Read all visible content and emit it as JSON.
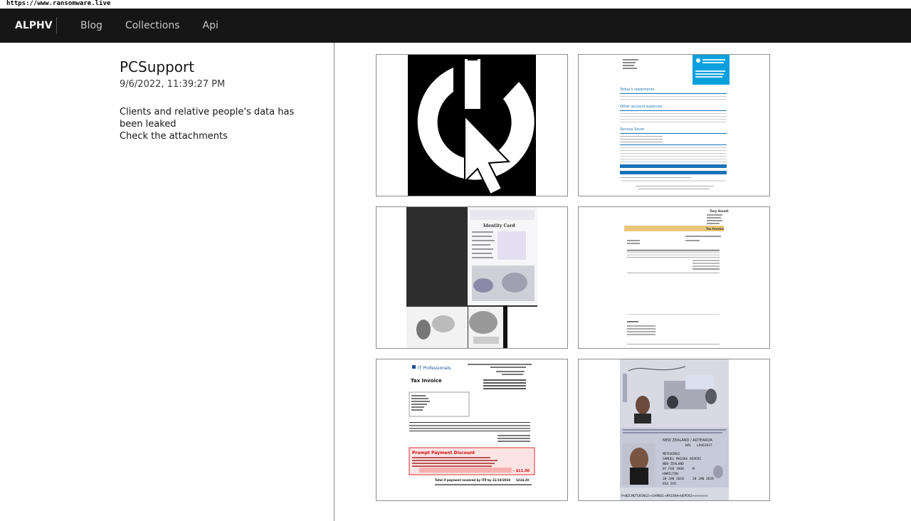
{
  "browser": {
    "url": "https://www.ransomware.live"
  },
  "navbar": {
    "brand": "ALPHV",
    "links": [
      {
        "label": "Blog"
      },
      {
        "label": "Collections"
      },
      {
        "label": "Api"
      }
    ]
  },
  "post": {
    "title": "PCSupport",
    "date": "9/6/2022, 11:39:27 PM",
    "body_lines": [
      "Clients and relative people's data has been leaked",
      "Check the attachments"
    ]
  },
  "attachments": [
    {
      "name": "pcsupport-logo"
    },
    {
      "name": "bank-statement"
    },
    {
      "name": "identity-card-scans"
    },
    {
      "name": "tax-invoice-tony-assadi"
    },
    {
      "name": "it-professionals-tax-invoice"
    },
    {
      "name": "new-zealand-passport"
    }
  ],
  "documents": {
    "bank_statement": {
      "section1": "Today's statements",
      "section2": "Other account balances",
      "section3": "Serious Saver"
    },
    "identity_card": {
      "title": "Identity Card"
    },
    "tax_invoice": {
      "name": "Tony Assadi",
      "heading": "Tax Invoice"
    },
    "itp_invoice": {
      "company": "IT Professionals",
      "heading": "Tax Invoice",
      "discount_heading": "Prompt Payment Discount",
      "discount_value": "- $11.00",
      "total_line": "Total if payment received by ITP by 31/10/2019",
      "total_value": "$224.20"
    },
    "passport": {
      "country": "NEW ZEALAND / AOTEAROA",
      "code": "NZL",
      "number": "LR461937",
      "surname": "METEKINGI",
      "given_names": "SAMUEL MAIOHA HEPERI",
      "nationality": "NEW ZEALAND",
      "dob": "07 FEB 1990",
      "sex": "M",
      "place": "HAMILTON",
      "issue": "20 JAN 2018",
      "expiry": "20 JAN 2028",
      "authority": "DIA SYD",
      "mrz": "P<NZLMETEKINGI<<SAMUEL<MAIOHA<HEPERI<<<<<<<<"
    }
  }
}
